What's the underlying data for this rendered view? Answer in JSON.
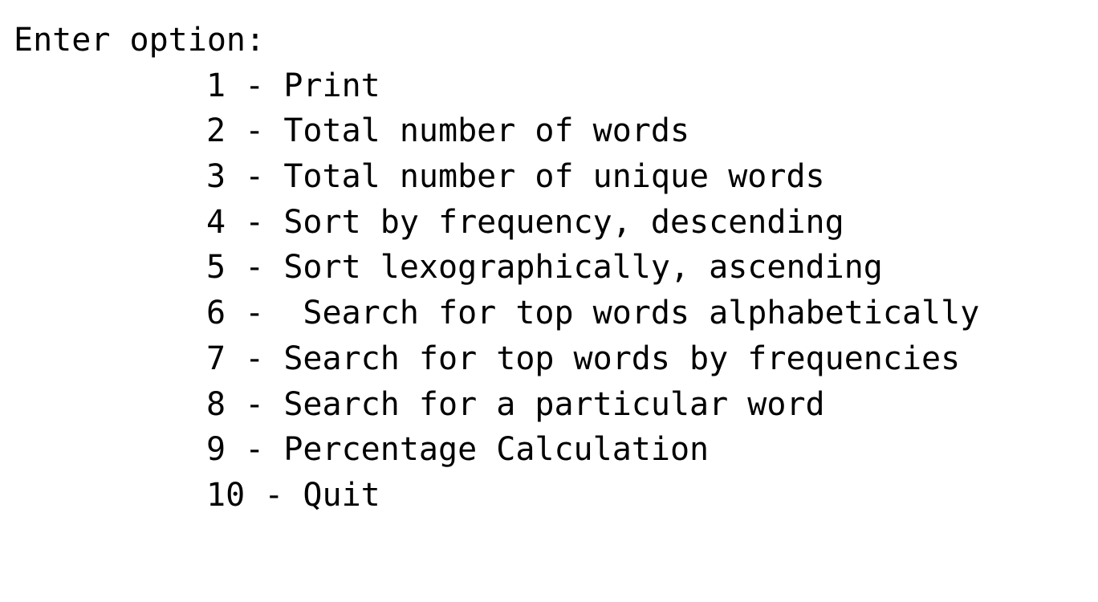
{
  "terminal": {
    "prompt": "Enter option:",
    "options": [
      "1 - Print",
      "2 - Total number of words",
      "3 - Total number of unique words",
      "4 - Sort by frequency, descending",
      "5 - Sort lexographically, ascending",
      "6 -  Search for top words alphabetically",
      "7 - Search for top words by frequencies",
      "8 - Search for a particular word",
      "9 - Percentage Calculation",
      "10 - Quit"
    ]
  }
}
